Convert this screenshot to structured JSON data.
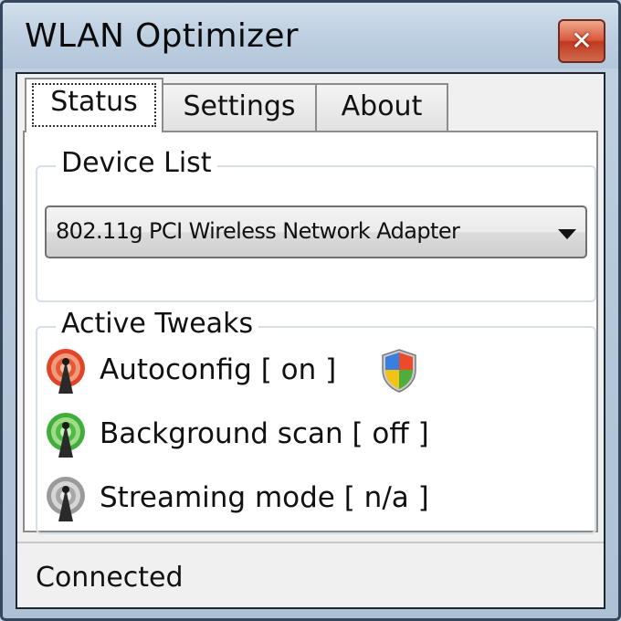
{
  "window": {
    "title": "WLAN Optimizer",
    "close_label": "✕"
  },
  "tabs": [
    {
      "label": "Status",
      "active": true
    },
    {
      "label": "Settings",
      "active": false
    },
    {
      "label": "About",
      "active": false
    }
  ],
  "device_list": {
    "title": "Device List",
    "selected_device": "802.11g PCI Wireless Network Adapter"
  },
  "active_tweaks": {
    "title": "Active Tweaks",
    "items": [
      {
        "label": "Autoconfig [ on ]",
        "icon": "antenna-red-icon",
        "color": "#e0452a",
        "has_shield": true
      },
      {
        "label": "Background scan [ off ]",
        "icon": "antenna-green-icon",
        "color": "#3fae3a",
        "has_shield": false
      },
      {
        "label": "Streaming mode [ n/a ]",
        "icon": "antenna-gray-icon",
        "color": "#9a9a9a",
        "has_shield": false
      }
    ]
  },
  "status_bar": {
    "text": "Connected"
  },
  "colors": {
    "titlebar": "#bccee0",
    "close_button": "#d9573c",
    "panel_bg": "#ffffff"
  }
}
